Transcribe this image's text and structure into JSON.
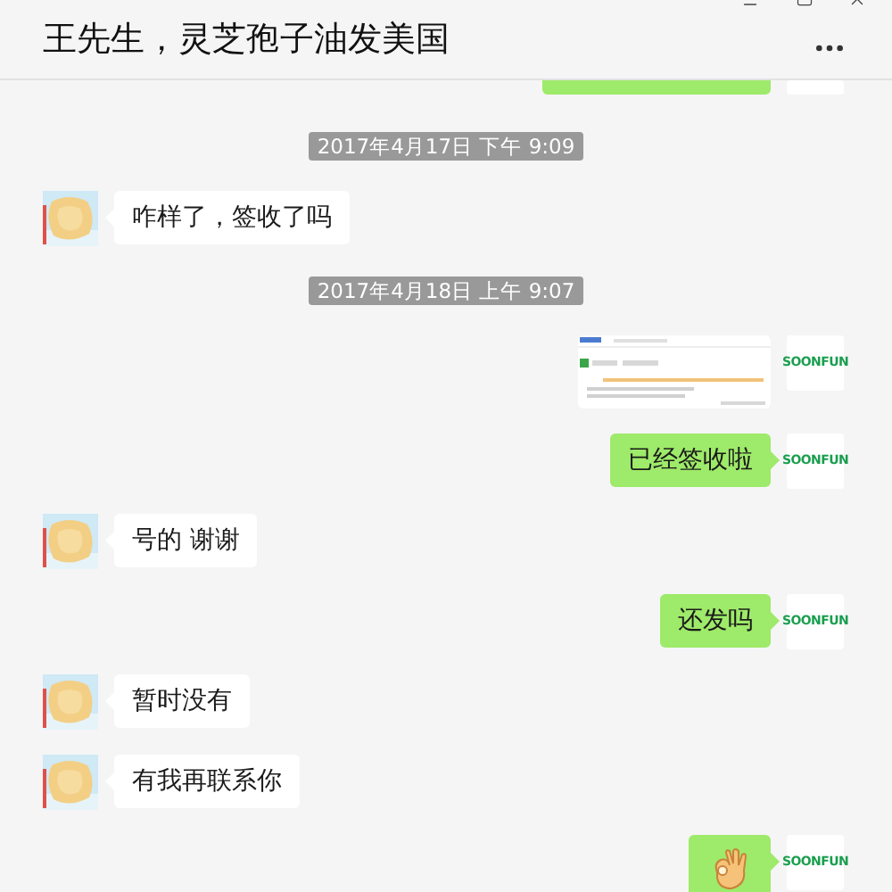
{
  "window": {
    "title": "王先生，灵芝孢子油发美国"
  },
  "messages": [
    {
      "kind": "sent_partial"
    },
    {
      "kind": "time",
      "text": "2017年4月17日 下午 9:09"
    },
    {
      "kind": "received_text",
      "text": "咋样了，签收了吗"
    },
    {
      "kind": "time",
      "text": "2017年4月18日 上午 9:07"
    },
    {
      "kind": "sent_image",
      "avatar_label": "SOONFUN"
    },
    {
      "kind": "sent_text",
      "text": "已经签收啦",
      "avatar_label": "SOONFUN"
    },
    {
      "kind": "received_text",
      "text": "号的 谢谢"
    },
    {
      "kind": "sent_text",
      "text": "还发吗",
      "avatar_label": "SOONFUN"
    },
    {
      "kind": "received_text",
      "text": "暂时没有"
    },
    {
      "kind": "received_text",
      "text": "有我再联系你"
    },
    {
      "kind": "sent_emoji",
      "avatar_label": "SOONFUN"
    }
  ]
}
